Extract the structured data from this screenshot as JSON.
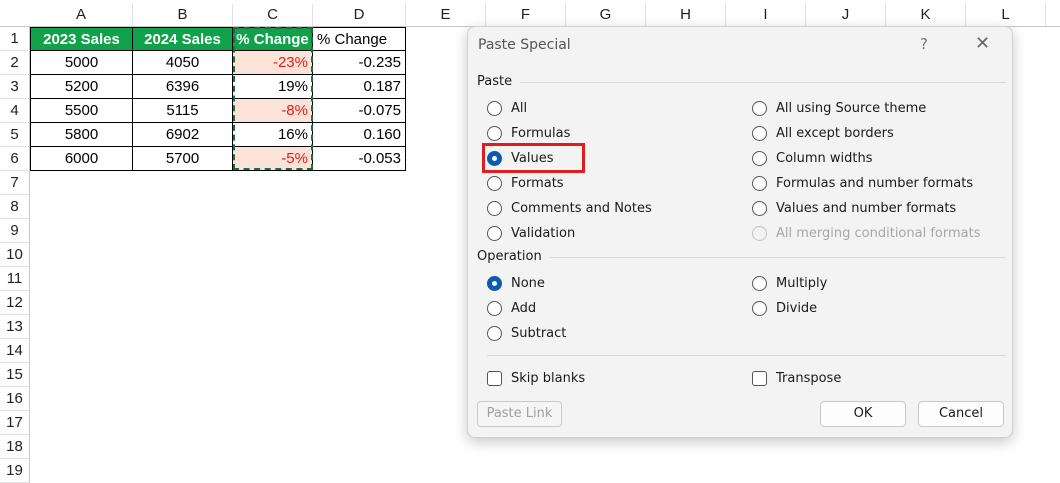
{
  "sheet": {
    "columns": [
      "A",
      "B",
      "C",
      "D",
      "E",
      "F",
      "G",
      "H",
      "I",
      "J",
      "K",
      "L"
    ],
    "rows": [
      "1",
      "2",
      "3",
      "4",
      "5",
      "6",
      "7",
      "8",
      "9",
      "10",
      "11",
      "12",
      "13",
      "14",
      "15",
      "16",
      "17",
      "18",
      "19"
    ],
    "headers": {
      "a1": "2023 Sales",
      "b1": "2024 Sales",
      "c1": "% Change",
      "d1": "% Change"
    },
    "data": [
      {
        "a": "5000",
        "b": "4050",
        "c": "-23%",
        "d": "-0.235"
      },
      {
        "a": "5200",
        "b": "6396",
        "c": "19%",
        "d": "0.187"
      },
      {
        "a": "5500",
        "b": "5115",
        "c": "-8%",
        "d": "-0.075"
      },
      {
        "a": "5800",
        "b": "6902",
        "c": "16%",
        "d": "0.160"
      },
      {
        "a": "6000",
        "b": "5700",
        "c": "-5%",
        "d": "-0.053"
      }
    ],
    "colors": {
      "header_green": "#10a14a",
      "negative_red": "#e01d1d",
      "negative_fill": "#fbe3d7",
      "copy_marquee": "#1e6b3a"
    }
  },
  "dialog": {
    "title": "Paste Special",
    "help": "?",
    "close": "✕",
    "paste_group": "Paste",
    "paste_left": [
      "All",
      "Formulas",
      "Values",
      "Formats",
      "Comments and Notes",
      "Validation"
    ],
    "paste_right": [
      "All using Source theme",
      "All except borders",
      "Column widths",
      "Formulas and number formats",
      "Values and number formats",
      "All merging conditional formats"
    ],
    "paste_selected": "Values",
    "paste_disabled": "All merging conditional formats",
    "operation_group": "Operation",
    "operation_left": [
      "None",
      "Add",
      "Subtract"
    ],
    "operation_right": [
      "Multiply",
      "Divide"
    ],
    "operation_selected": "None",
    "skip_blanks": "Skip blanks",
    "transpose": "Transpose",
    "paste_link": "Paste Link",
    "ok": "OK",
    "cancel": "Cancel",
    "accent": "#0b5cad",
    "highlight_color": "#e01d1d"
  }
}
